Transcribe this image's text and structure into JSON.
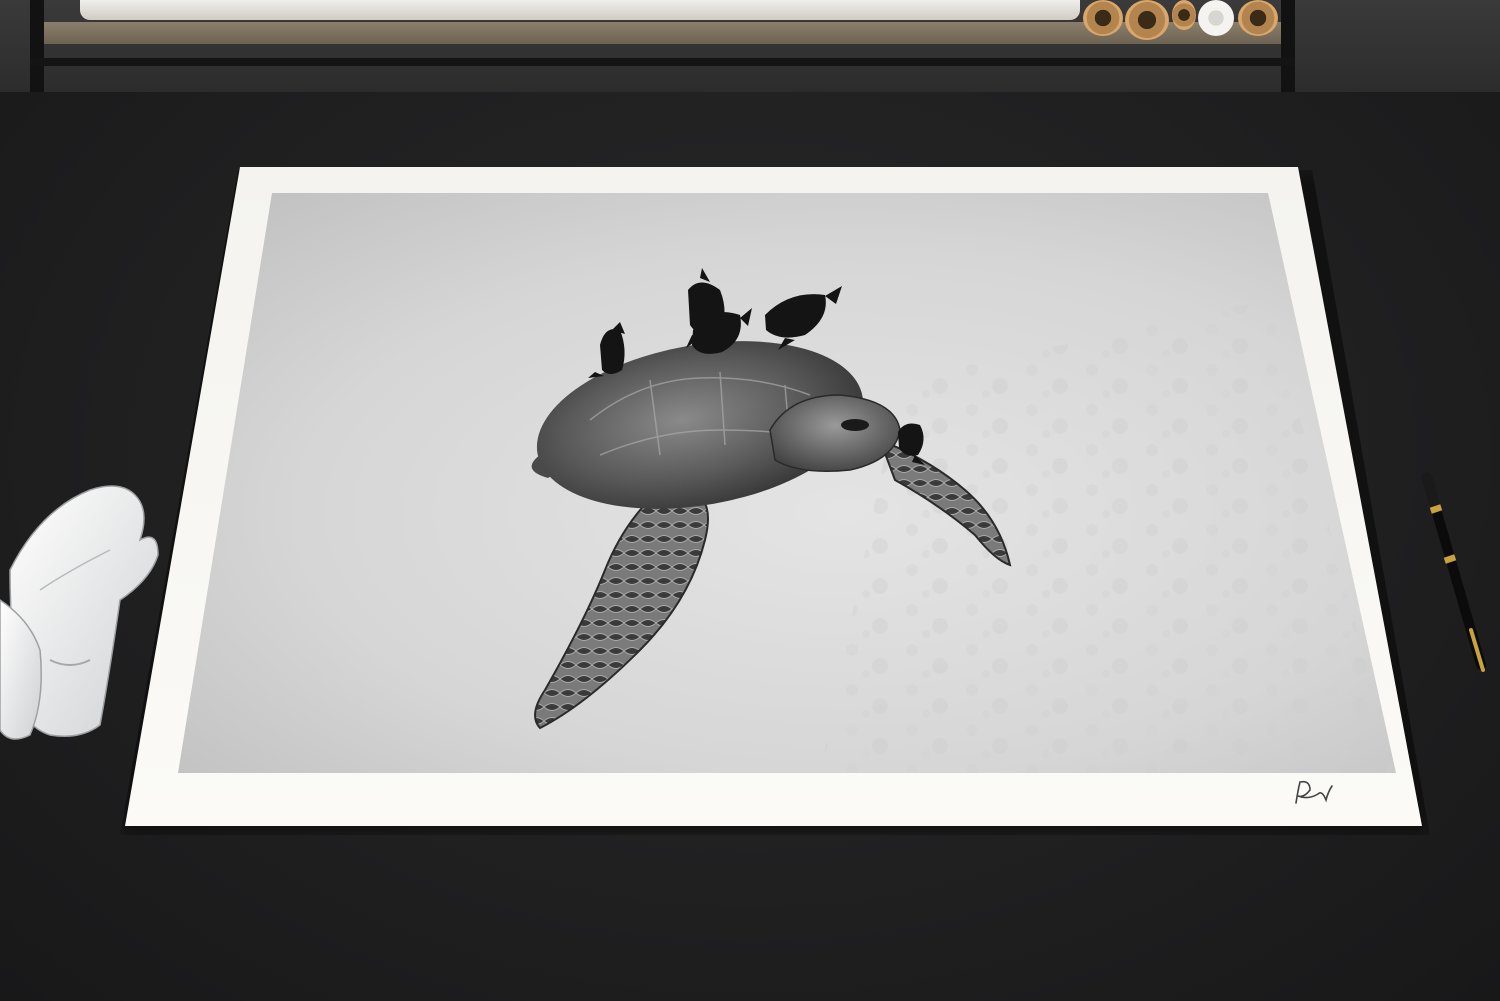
{
  "scene": {
    "description_text": "",
    "colors": {
      "desk": "#202021",
      "paper_border": "#f7f6f3",
      "photo_background": "#d4d4d4",
      "fish": "#141414"
    },
    "objects": {
      "gloves_icon": "white-cotton-gloves-icon",
      "pen_icon": "fountain-pen-icon",
      "signature_icon": "signature-icon"
    }
  }
}
